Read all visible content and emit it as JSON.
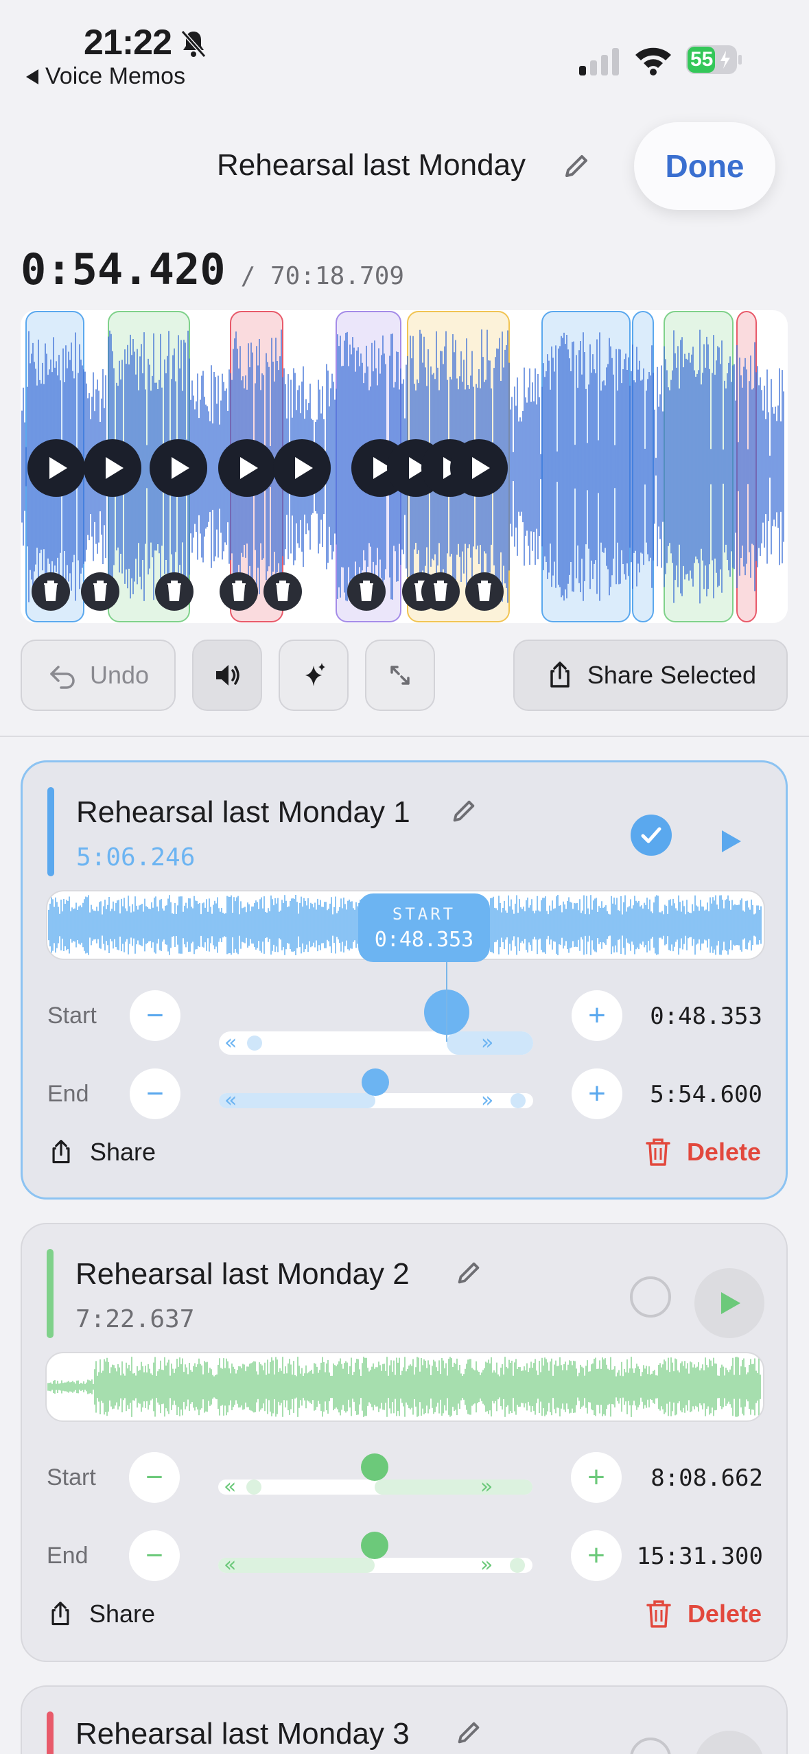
{
  "status_bar": {
    "time": "21:22",
    "back_label": "Voice Memos",
    "battery": "55"
  },
  "header": {
    "title": "Rehearsal last Monday",
    "done_label": "Done"
  },
  "playback": {
    "current": "0:54.420",
    "total": "/ 70:18.709"
  },
  "toolbar": {
    "undo_label": "Undo",
    "share_selected_label": "Share Selected"
  },
  "colors": {
    "blue": "#5aa8ee",
    "green": "#7fd18a",
    "red": "#e85a6a",
    "purple": "#a48be8",
    "yellow": "#f1c453",
    "delete_red": "#e2483d",
    "done_blue": "#3a6fd0"
  },
  "segments_overview": [
    {
      "color": "blue"
    },
    {
      "color": "green"
    },
    {
      "color": "red"
    },
    {
      "color": "purple"
    },
    {
      "color": "yellow"
    },
    {
      "color": "blue"
    },
    {
      "color": "blue"
    },
    {
      "color": "green"
    },
    {
      "color": "red"
    }
  ],
  "clips": [
    {
      "title": "Rehearsal last Monday 1",
      "duration": "5:06.246",
      "color": "blue",
      "selected": true,
      "start_label": "Start",
      "end_label": "End",
      "start_value": "0:48.353",
      "end_value": "5:54.600",
      "start_tag_label": "START",
      "start_tag_value": "0:48.353",
      "share_label": "Share",
      "delete_label": "Delete"
    },
    {
      "title": "Rehearsal last Monday 2",
      "duration": "7:22.637",
      "color": "green",
      "selected": false,
      "start_label": "Start",
      "end_label": "End",
      "start_value": "8:08.662",
      "end_value": "15:31.300",
      "share_label": "Share",
      "delete_label": "Delete"
    },
    {
      "title": "Rehearsal last Monday 3",
      "color": "red"
    }
  ]
}
